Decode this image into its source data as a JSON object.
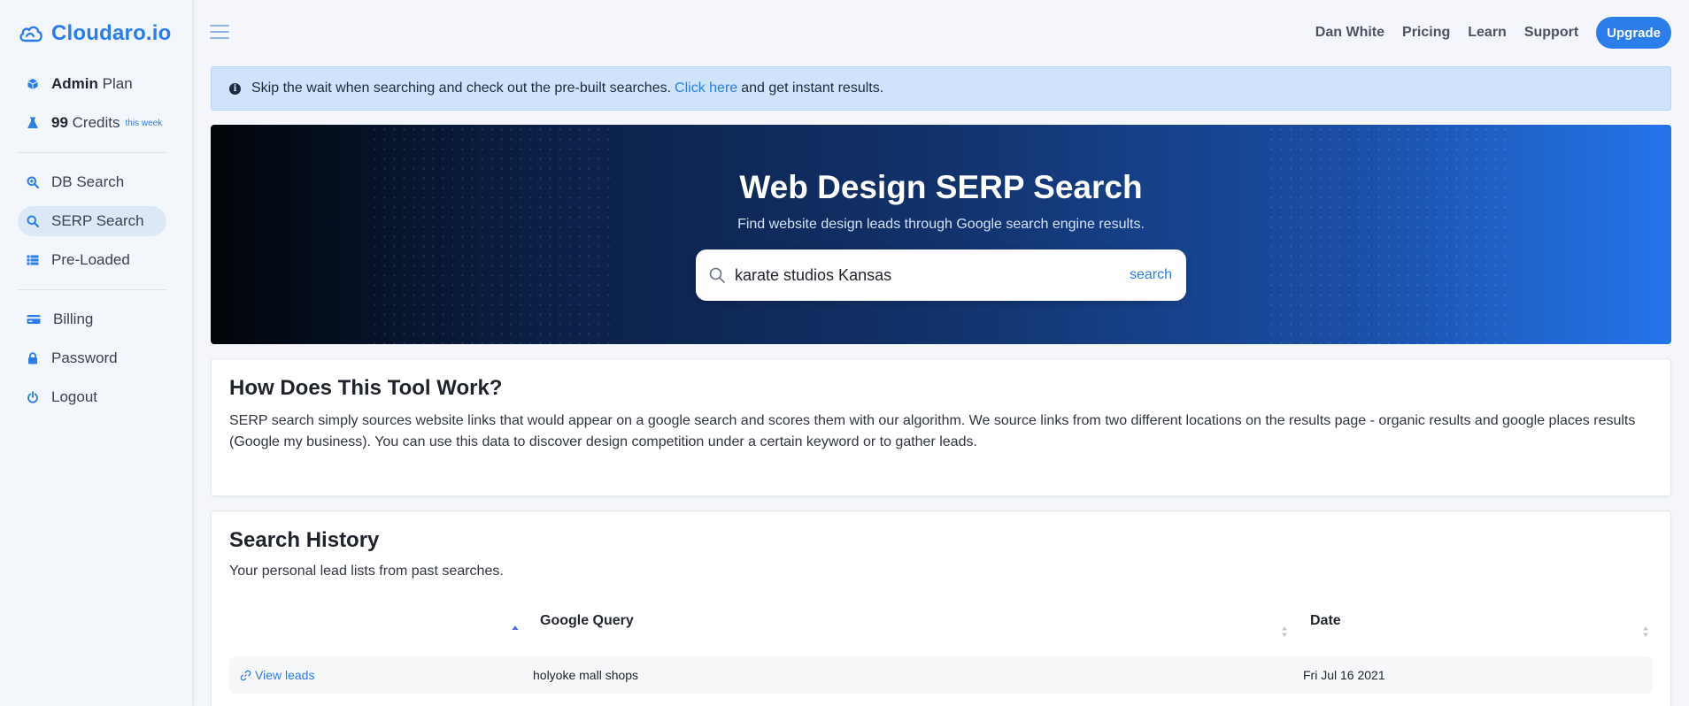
{
  "brand": {
    "name": "Cloudaro.io"
  },
  "sidebar": {
    "plan": {
      "bold": "Admin",
      "rest": "Plan"
    },
    "credits": {
      "bold": "99",
      "rest": "Credits",
      "note": "this week"
    },
    "items": [
      {
        "label": "DB Search",
        "icon": "search-plus-icon"
      },
      {
        "label": "SERP Search",
        "icon": "search-icon",
        "active": true
      },
      {
        "label": "Pre-Loaded",
        "icon": "list-icon"
      },
      {
        "label": "Billing",
        "icon": "credit-card-icon"
      },
      {
        "label": "Password",
        "icon": "lock-icon"
      },
      {
        "label": "Logout",
        "icon": "power-icon"
      }
    ]
  },
  "topnav": {
    "user": "Dan White",
    "pricing": "Pricing",
    "learn": "Learn",
    "support": "Support",
    "upgrade": "Upgrade"
  },
  "alert": {
    "before": "Skip the wait when searching and check out the pre-built searches.",
    "link": "Click here",
    "after": "and get instant results."
  },
  "hero": {
    "title": "Web Design SERP Search",
    "subtitle": "Find website design leads through Google search engine results.",
    "search_value": "karate studios Kansas",
    "search_button": "search"
  },
  "how": {
    "title": "How Does This Tool Work?",
    "text": "SERP search simply sources website links that would appear on a google search and scores them with our algorithm. We source links from two different locations on the results page - organic results and google places results (Google my business). You can use this data to discover design competition under a certain keyword or to gather leads."
  },
  "history": {
    "title": "Search History",
    "subtitle": "Your personal lead lists from past searches.",
    "columns": [
      "",
      "Google Query",
      "Date"
    ],
    "rows": [
      {
        "link": "View leads",
        "query": "holyoke mall shops",
        "date": "Fri Jul 16 2021"
      }
    ]
  },
  "colors": {
    "accent": "#2b7de9",
    "alert_bg": "#cfe3fb",
    "hero_start": "#020509",
    "hero_end": "#2475ea"
  }
}
